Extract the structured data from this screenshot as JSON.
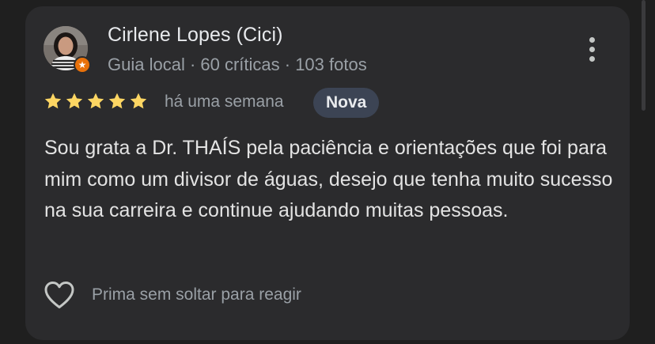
{
  "review": {
    "author_name": "Cirlene Lopes (Cici)",
    "author_meta": "Guia local · 60 críticas · 103 fotos",
    "rating": 5,
    "rating_max": 5,
    "time_ago": "há uma semana",
    "new_badge": "Nova",
    "text": "Sou grata a Dr. THAÍS pela paciência e orientações que foi para mim como um divisor de águas, desejo que tenha muito sucesso na sua carreira e continue ajudando muitas pessoas.",
    "react_prompt": "Prima sem soltar para reagir"
  },
  "icons": {
    "avatar": "user-avatar",
    "guide_badge": "local-guide-badge-icon",
    "more": "more-vert-icon",
    "star": "star-icon",
    "heart": "heart-outline-icon"
  },
  "colors": {
    "background": "#1f1f1f",
    "card": "#2b2b2d",
    "star": "#fdd663",
    "guide_badge": "#e8710a",
    "new_badge_bg": "#3c4454",
    "primary_text": "#e8eaed",
    "secondary_text": "#9aa0a6"
  }
}
